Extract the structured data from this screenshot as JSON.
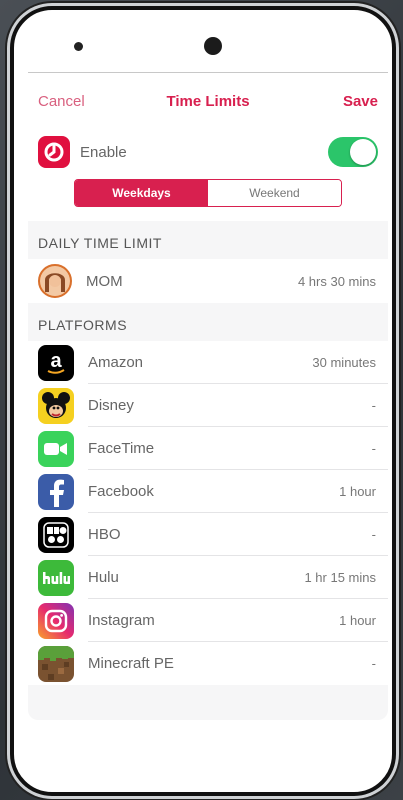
{
  "nav": {
    "cancel": "Cancel",
    "title": "Time Limits",
    "save": "Save"
  },
  "enable": {
    "label": "Enable",
    "on": true,
    "toggle_color": "#2bc56a",
    "icon": "clock-icon"
  },
  "schedule": {
    "options": [
      "Weekdays",
      "Weekend"
    ],
    "selected": "Weekdays"
  },
  "daily_limit": {
    "header": "DAILY TIME LIMIT",
    "profile_name": "MOM",
    "value": "4 hrs 30 mins",
    "icon": "avatar"
  },
  "platforms": {
    "header": "PLATFORMS",
    "items": [
      {
        "name": "Amazon",
        "value": "30 minutes",
        "icon": "amazon-icon"
      },
      {
        "name": "Disney",
        "value": "-",
        "icon": "disney-icon"
      },
      {
        "name": "FaceTime",
        "value": "-",
        "icon": "facetime-icon"
      },
      {
        "name": "Facebook",
        "value": "1 hour",
        "icon": "facebook-icon"
      },
      {
        "name": "HBO",
        "value": "-",
        "icon": "hbo-icon"
      },
      {
        "name": "Hulu",
        "value": "1 hr 15 mins",
        "icon": "hulu-icon"
      },
      {
        "name": "Instagram",
        "value": "1 hour",
        "icon": "instagram-icon"
      },
      {
        "name": "Minecraft PE",
        "value": "-",
        "icon": "minecraft-icon"
      }
    ]
  },
  "colors": {
    "accent": "#d8204f",
    "cancel": "#d9607f"
  }
}
